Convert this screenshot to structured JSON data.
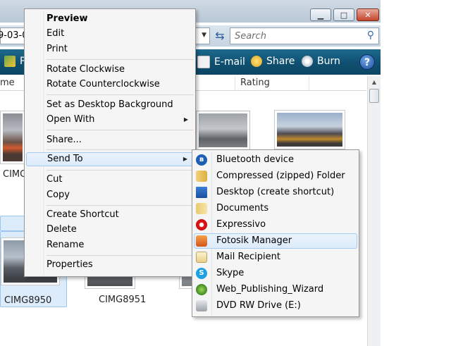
{
  "window": {
    "minimize_glyph": "▁",
    "maximize_glyph": "□",
    "close_glyph": "✕"
  },
  "address": {
    "path_text": "9-03-0",
    "dropdown_glyph": "▼"
  },
  "search": {
    "placeholder": "Search"
  },
  "toolbar": {
    "partial_label": "P",
    "email_label": "E-mail",
    "share_label": "Share",
    "burn_label": "Burn",
    "help_label": "?"
  },
  "columns": {
    "name_partial": "me",
    "rating": "Rating"
  },
  "files": [
    {
      "label": "CIMG",
      "partial": true
    },
    {
      "label": "CIMG8950"
    },
    {
      "label": "CIMG8951"
    }
  ],
  "context_menu": {
    "items": [
      {
        "label": "Preview",
        "bold": true
      },
      {
        "label": "Edit"
      },
      {
        "label": "Print"
      },
      {
        "label": "Rotate Clockwise"
      },
      {
        "label": "Rotate Counterclockwise"
      },
      {
        "label": "Set as Desktop Background"
      },
      {
        "label": "Open With",
        "submenu": true
      },
      {
        "label": "Share..."
      },
      {
        "label": "Send To",
        "submenu": true,
        "highlighted": true
      },
      {
        "label": "Cut"
      },
      {
        "label": "Copy"
      },
      {
        "label": "Create Shortcut"
      },
      {
        "label": "Delete"
      },
      {
        "label": "Rename"
      },
      {
        "label": "Properties"
      }
    ],
    "submenu_arrow": "▶"
  },
  "send_to_menu": {
    "items": [
      {
        "label": "Bluetooth device",
        "icon": "bluetooth-icon"
      },
      {
        "label": "Compressed (zipped) Folder",
        "icon": "zip-folder-icon"
      },
      {
        "label": "Desktop (create shortcut)",
        "icon": "desktop-icon"
      },
      {
        "label": "Documents",
        "icon": "documents-folder-icon"
      },
      {
        "label": "Expressivo",
        "icon": "expressivo-icon"
      },
      {
        "label": "Fotosik Manager",
        "icon": "fotosik-icon",
        "highlighted": true
      },
      {
        "label": "Mail Recipient",
        "icon": "mail-icon"
      },
      {
        "label": "Skype",
        "icon": "skype-icon"
      },
      {
        "label": "Web_Publishing_Wizard",
        "icon": "web-wizard-icon"
      },
      {
        "label": "DVD RW Drive (E:)",
        "icon": "dvd-drive-icon"
      }
    ]
  },
  "colors": {
    "toolbar_bg": "#0f4f70",
    "menu_bg": "#f5f5f5",
    "highlight_bg": "#dcebfb",
    "highlight_border": "#a8cbf0"
  }
}
